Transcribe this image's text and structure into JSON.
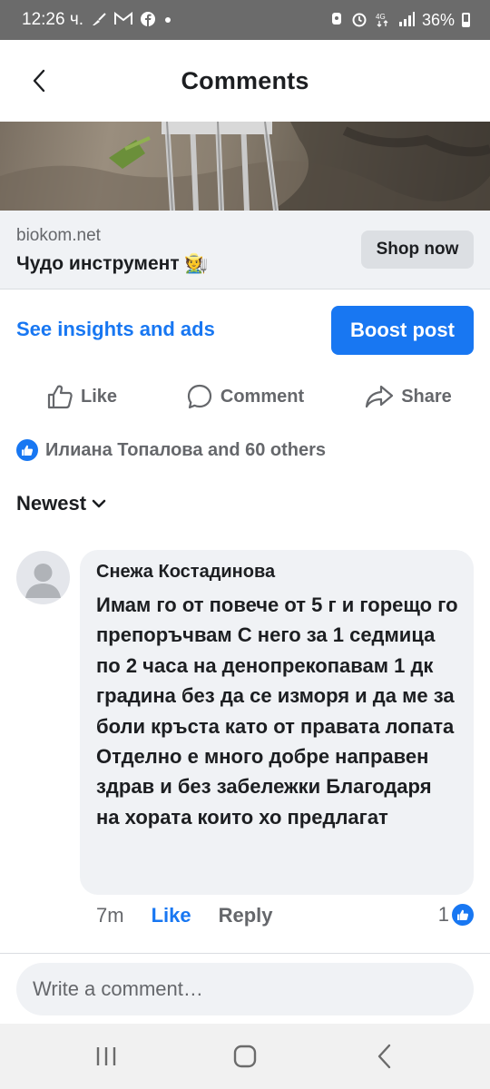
{
  "status_bar": {
    "time": "12:26 ч.",
    "left_icons": [
      "broom-icon",
      "gmail-icon",
      "facebook-icon",
      "dot-icon"
    ],
    "right_icons": [
      "silent-icon",
      "alarm-icon",
      "4g-icon",
      "signal-icon"
    ],
    "battery": "36%"
  },
  "header": {
    "title": "Comments",
    "back_icon": "chevron-left-icon"
  },
  "ad": {
    "domain": "biokom.net",
    "headline": "Чудо инструмент 🧑‍🌾",
    "cta": "Shop now"
  },
  "post_actions": {
    "insights_label": "See insights and ads",
    "boost_label": "Boost post"
  },
  "reactions_bar": {
    "like_label": "Like",
    "comment_label": "Comment",
    "share_label": "Share"
  },
  "reactions_summary": "Илиана Топалова and 60 others",
  "sort": {
    "label": "Newest"
  },
  "comment": {
    "author": "Снежа Костадинова",
    "text": "Имам го от повече от 5 г и горещо го препоръчвам С него за 1 седмица по 2 часа на денопрекопавам 1 дк градина без да се изморя и да ме за боли кръста като от правата лопата Отделно е много добре направен здрав и без забележки Благодаря на хората които хо предлагат",
    "time": "7m",
    "like_label": "Like",
    "reply_label": "Reply",
    "reaction_count": "1"
  },
  "composer": {
    "placeholder": "Write a comment…"
  },
  "colors": {
    "accent": "#1877f2",
    "status_bar": "#6b6b6b",
    "secondary_text": "#65676b",
    "bubble": "#f0f2f5"
  }
}
